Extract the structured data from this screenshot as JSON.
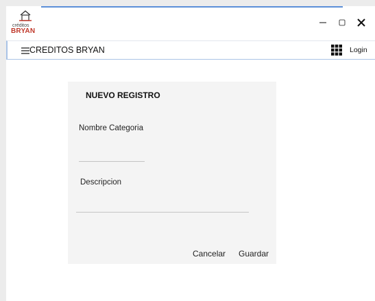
{
  "logo": {
    "small_text": "créditos",
    "brand_text": "BRYAN",
    "icon": "house-icon"
  },
  "window_controls": {
    "minimize_icon": "minimize-icon",
    "maximize_icon": "maximize-icon",
    "close_icon": "close-icon"
  },
  "menubar": {
    "menu_icon": "hamburger-menu-icon",
    "title": "CREDITOS BRYAN",
    "apps_icon": "grid-icon",
    "login_label": "Login"
  },
  "form": {
    "title": "NUEVO REGISTRO",
    "nombre_label": "Nombre Categoria",
    "nombre_value": "",
    "descripcion_label": "Descripcion",
    "descripcion_value": "",
    "cancel_label": "Cancelar",
    "save_label": "Guardar"
  },
  "colors": {
    "accent": "#5b8fd8",
    "brand_red": "#c0392b",
    "card_background": "#f4f4f4"
  }
}
